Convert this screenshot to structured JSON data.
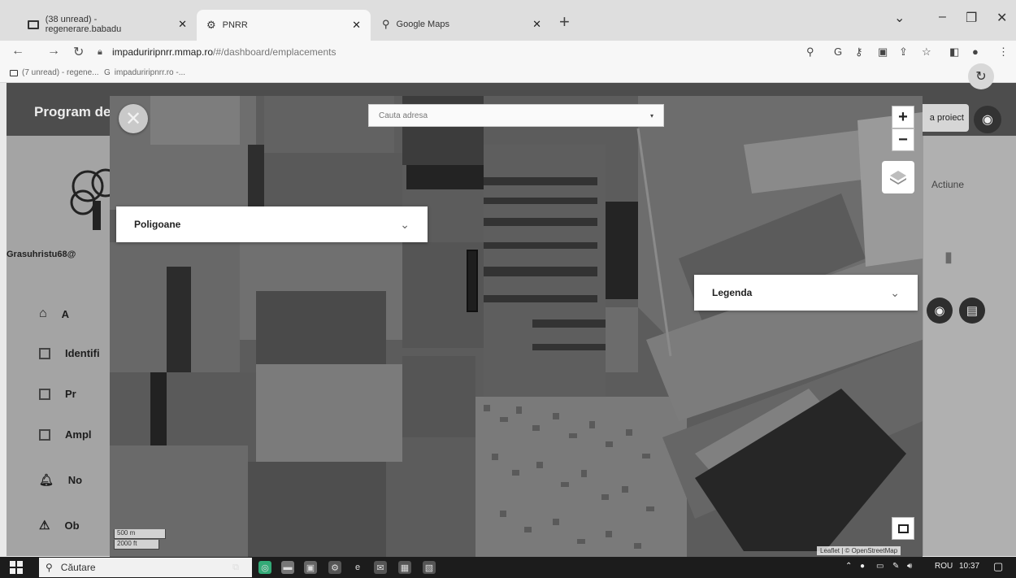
{
  "browser": {
    "tabs": [
      {
        "title": "(38 unread) - regenerare.babadu",
        "icon": "mail-icon"
      },
      {
        "title": "PNRR",
        "icon": "site-icon"
      },
      {
        "title": "Google Maps",
        "icon": "maps-pin-icon"
      }
    ],
    "url_host": "impaduriripnrr.mmap.ro",
    "url_path": "/#/dashboard/emplacements",
    "bookmarks": [
      {
        "label": "(7 unread) - regene...",
        "icon": "mail-icon"
      },
      {
        "label": "impaduriripnrr.ro -...",
        "icon": "google-icon"
      }
    ]
  },
  "app": {
    "title": "Program de",
    "username": "Grasuhristu68@",
    "sidebar": [
      {
        "label": "A",
        "icon": "home-icon"
      },
      {
        "label": "Identifi",
        "icon": "id-card-icon"
      },
      {
        "label": "Pr",
        "icon": "id-card-icon"
      },
      {
        "label": "Ampl",
        "icon": "id-card-icon"
      },
      {
        "label": "No",
        "icon": "bell-icon"
      },
      {
        "label": "Ob",
        "icon": "warning-icon"
      }
    ],
    "project_button": "a proiect",
    "actions_header": "Actiune"
  },
  "map": {
    "search_placeholder": "Cauta adresa",
    "zoom_in": "+",
    "zoom_out": "−",
    "polygons_panel": "Poligoane",
    "legend_panel": "Legenda",
    "scale_metric": "500 m",
    "scale_imperial": "2000 ft",
    "attribution": "Leaflet | © OpenStreetMap"
  },
  "taskbar": {
    "search_placeholder": "Căutare",
    "language": "ROU",
    "time": "10:37"
  }
}
